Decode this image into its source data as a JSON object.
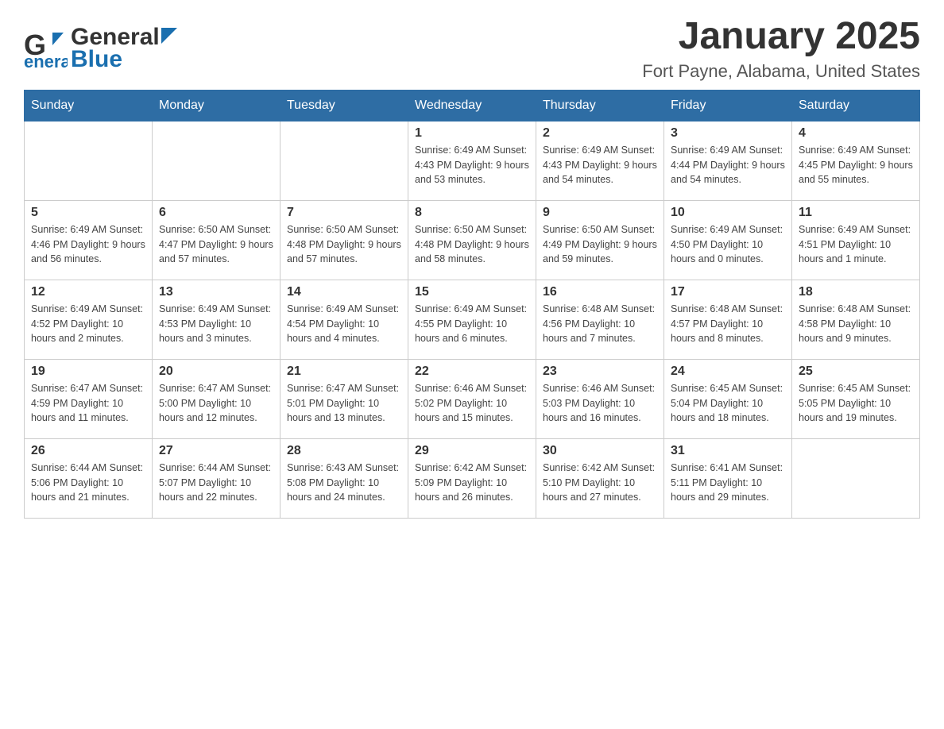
{
  "header": {
    "logo_general": "General",
    "logo_blue": "Blue",
    "month_title": "January 2025",
    "location": "Fort Payne, Alabama, United States"
  },
  "weekdays": [
    "Sunday",
    "Monday",
    "Tuesday",
    "Wednesday",
    "Thursday",
    "Friday",
    "Saturday"
  ],
  "weeks": [
    [
      {
        "day": "",
        "info": ""
      },
      {
        "day": "",
        "info": ""
      },
      {
        "day": "",
        "info": ""
      },
      {
        "day": "1",
        "info": "Sunrise: 6:49 AM\nSunset: 4:43 PM\nDaylight: 9 hours\nand 53 minutes."
      },
      {
        "day": "2",
        "info": "Sunrise: 6:49 AM\nSunset: 4:43 PM\nDaylight: 9 hours\nand 54 minutes."
      },
      {
        "day": "3",
        "info": "Sunrise: 6:49 AM\nSunset: 4:44 PM\nDaylight: 9 hours\nand 54 minutes."
      },
      {
        "day": "4",
        "info": "Sunrise: 6:49 AM\nSunset: 4:45 PM\nDaylight: 9 hours\nand 55 minutes."
      }
    ],
    [
      {
        "day": "5",
        "info": "Sunrise: 6:49 AM\nSunset: 4:46 PM\nDaylight: 9 hours\nand 56 minutes."
      },
      {
        "day": "6",
        "info": "Sunrise: 6:50 AM\nSunset: 4:47 PM\nDaylight: 9 hours\nand 57 minutes."
      },
      {
        "day": "7",
        "info": "Sunrise: 6:50 AM\nSunset: 4:48 PM\nDaylight: 9 hours\nand 57 minutes."
      },
      {
        "day": "8",
        "info": "Sunrise: 6:50 AM\nSunset: 4:48 PM\nDaylight: 9 hours\nand 58 minutes."
      },
      {
        "day": "9",
        "info": "Sunrise: 6:50 AM\nSunset: 4:49 PM\nDaylight: 9 hours\nand 59 minutes."
      },
      {
        "day": "10",
        "info": "Sunrise: 6:49 AM\nSunset: 4:50 PM\nDaylight: 10 hours\nand 0 minutes."
      },
      {
        "day": "11",
        "info": "Sunrise: 6:49 AM\nSunset: 4:51 PM\nDaylight: 10 hours\nand 1 minute."
      }
    ],
    [
      {
        "day": "12",
        "info": "Sunrise: 6:49 AM\nSunset: 4:52 PM\nDaylight: 10 hours\nand 2 minutes."
      },
      {
        "day": "13",
        "info": "Sunrise: 6:49 AM\nSunset: 4:53 PM\nDaylight: 10 hours\nand 3 minutes."
      },
      {
        "day": "14",
        "info": "Sunrise: 6:49 AM\nSunset: 4:54 PM\nDaylight: 10 hours\nand 4 minutes."
      },
      {
        "day": "15",
        "info": "Sunrise: 6:49 AM\nSunset: 4:55 PM\nDaylight: 10 hours\nand 6 minutes."
      },
      {
        "day": "16",
        "info": "Sunrise: 6:48 AM\nSunset: 4:56 PM\nDaylight: 10 hours\nand 7 minutes."
      },
      {
        "day": "17",
        "info": "Sunrise: 6:48 AM\nSunset: 4:57 PM\nDaylight: 10 hours\nand 8 minutes."
      },
      {
        "day": "18",
        "info": "Sunrise: 6:48 AM\nSunset: 4:58 PM\nDaylight: 10 hours\nand 9 minutes."
      }
    ],
    [
      {
        "day": "19",
        "info": "Sunrise: 6:47 AM\nSunset: 4:59 PM\nDaylight: 10 hours\nand 11 minutes."
      },
      {
        "day": "20",
        "info": "Sunrise: 6:47 AM\nSunset: 5:00 PM\nDaylight: 10 hours\nand 12 minutes."
      },
      {
        "day": "21",
        "info": "Sunrise: 6:47 AM\nSunset: 5:01 PM\nDaylight: 10 hours\nand 13 minutes."
      },
      {
        "day": "22",
        "info": "Sunrise: 6:46 AM\nSunset: 5:02 PM\nDaylight: 10 hours\nand 15 minutes."
      },
      {
        "day": "23",
        "info": "Sunrise: 6:46 AM\nSunset: 5:03 PM\nDaylight: 10 hours\nand 16 minutes."
      },
      {
        "day": "24",
        "info": "Sunrise: 6:45 AM\nSunset: 5:04 PM\nDaylight: 10 hours\nand 18 minutes."
      },
      {
        "day": "25",
        "info": "Sunrise: 6:45 AM\nSunset: 5:05 PM\nDaylight: 10 hours\nand 19 minutes."
      }
    ],
    [
      {
        "day": "26",
        "info": "Sunrise: 6:44 AM\nSunset: 5:06 PM\nDaylight: 10 hours\nand 21 minutes."
      },
      {
        "day": "27",
        "info": "Sunrise: 6:44 AM\nSunset: 5:07 PM\nDaylight: 10 hours\nand 22 minutes."
      },
      {
        "day": "28",
        "info": "Sunrise: 6:43 AM\nSunset: 5:08 PM\nDaylight: 10 hours\nand 24 minutes."
      },
      {
        "day": "29",
        "info": "Sunrise: 6:42 AM\nSunset: 5:09 PM\nDaylight: 10 hours\nand 26 minutes."
      },
      {
        "day": "30",
        "info": "Sunrise: 6:42 AM\nSunset: 5:10 PM\nDaylight: 10 hours\nand 27 minutes."
      },
      {
        "day": "31",
        "info": "Sunrise: 6:41 AM\nSunset: 5:11 PM\nDaylight: 10 hours\nand 29 minutes."
      },
      {
        "day": "",
        "info": ""
      }
    ]
  ]
}
